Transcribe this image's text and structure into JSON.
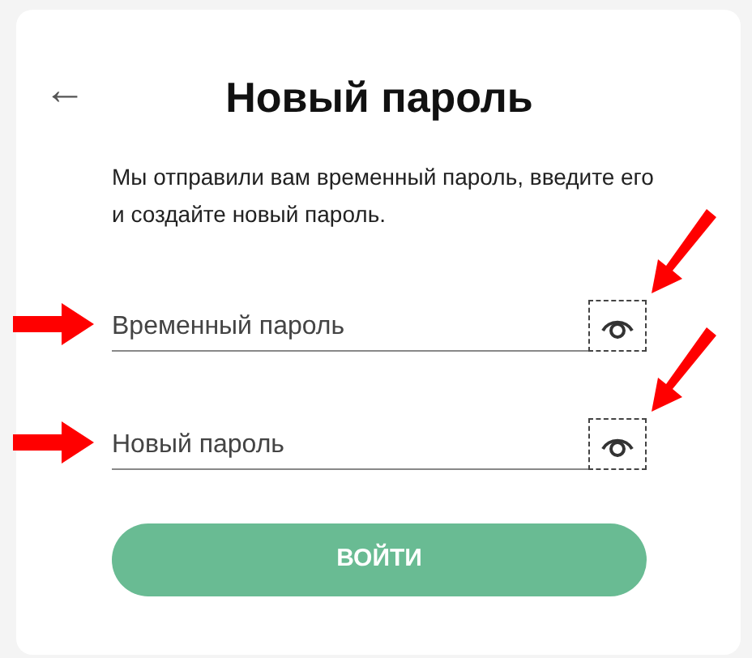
{
  "back_button": {
    "label": "←"
  },
  "title": "Новый пароль",
  "message": "Мы отправили вам временный пароль, введите его и создайте новый пароль.",
  "fields": [
    {
      "placeholder": "Временный пароль",
      "arrow_marked": true,
      "eye_toggle": {
        "outlined": true,
        "arrow_marked": true
      }
    },
    {
      "placeholder": "Новый пароль",
      "arrow_marked": true,
      "eye_toggle": {
        "outlined": true,
        "arrow_marked": true
      }
    }
  ],
  "submit_button": {
    "label": "ВОЙТИ"
  }
}
